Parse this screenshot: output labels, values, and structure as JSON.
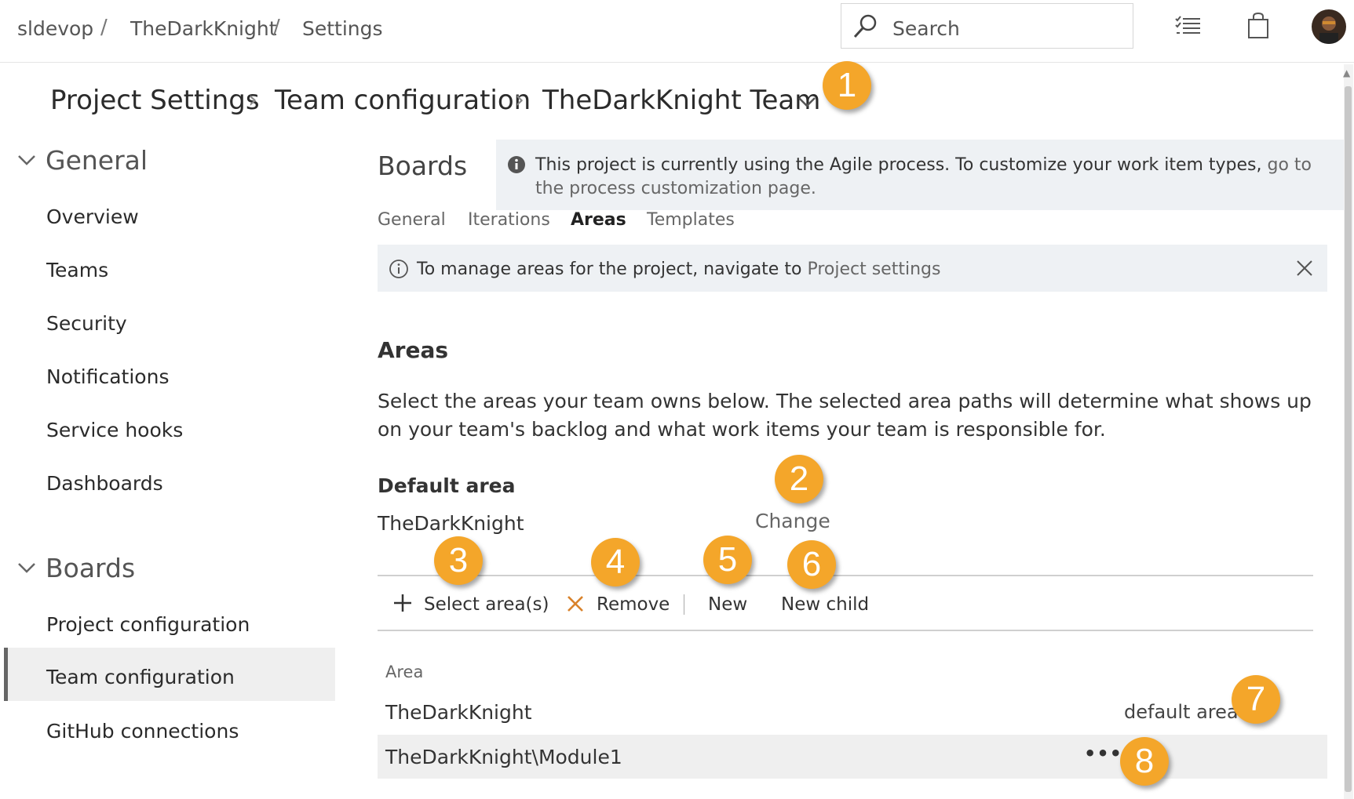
{
  "topbar": {
    "breadcrumbs": [
      "sldevop",
      "TheDarkKnight",
      "Settings"
    ],
    "separator": "/",
    "search_placeholder": "Search"
  },
  "header": {
    "crumbs": [
      "Project Settings",
      "Team configuration",
      "TheDarkKnight Team"
    ],
    "separator": "›"
  },
  "sidebar": {
    "groups": [
      {
        "label": "General",
        "items": [
          "Overview",
          "Teams",
          "Security",
          "Notifications",
          "Service hooks",
          "Dashboards"
        ]
      },
      {
        "label": "Boards",
        "items": [
          "Project configuration",
          "Team configuration",
          "GitHub connections"
        ]
      }
    ],
    "selected_item": "Team configuration"
  },
  "main": {
    "title": "Boards",
    "process_banner": {
      "text": "This project is currently using the Agile process. To customize your work item types,",
      "link": "go to the process customization page."
    },
    "tabs": [
      "General",
      "Iterations",
      "Areas",
      "Templates"
    ],
    "active_tab": "Areas",
    "info_banner": {
      "text": "To manage areas for the project, navigate to",
      "link": "Project settings"
    },
    "areas_heading": "Areas",
    "description": "Select the areas your team owns below. The selected area paths will determine what shows up on your team's backlog and what work items your team is responsible for.",
    "default_area_heading": "Default area",
    "default_area_value": "TheDarkKnight",
    "change_label": "Change",
    "toolbar": {
      "select_label": "Select area(s)",
      "remove_label": "Remove",
      "new_label": "New",
      "new_child_label": "New child"
    },
    "table": {
      "column": "Area",
      "rows": [
        {
          "path": "TheDarkKnight",
          "tag": "default area"
        },
        {
          "path": "TheDarkKnight\\Module1",
          "tag": ""
        }
      ],
      "more_label": "•••"
    }
  },
  "callouts": [
    "1",
    "2",
    "3",
    "4",
    "5",
    "6",
    "7",
    "8"
  ],
  "colors": {
    "callout": "#f4a62a",
    "banner": "#eef1f4",
    "selected": "#efefef"
  }
}
